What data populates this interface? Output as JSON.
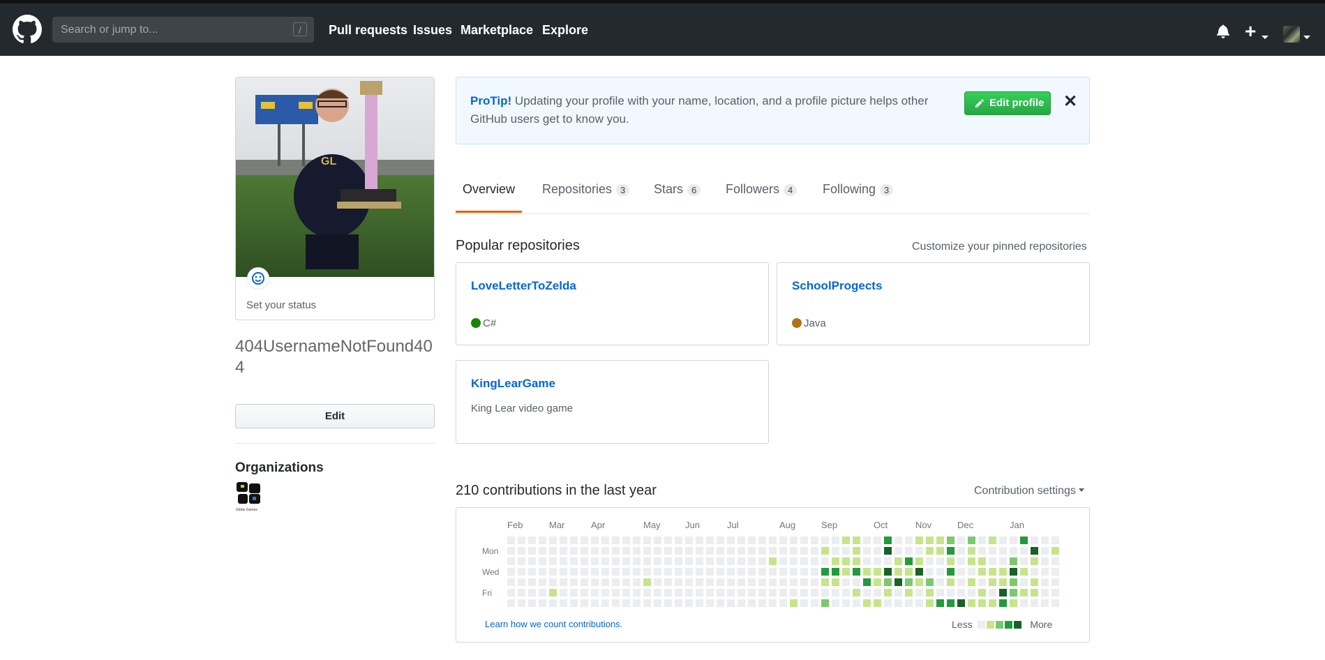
{
  "header": {
    "search_placeholder": "Search or jump to...",
    "search_hint": "/",
    "nav": [
      "Pull requests",
      "Issues",
      "Marketplace",
      "Explore"
    ]
  },
  "profile": {
    "status_text": "Set your status",
    "username": "404UsernameNotFound404",
    "edit_label": "Edit",
    "organizations_title": "Organizations",
    "org_name": "Glebe Games"
  },
  "protip": {
    "label": "ProTip!",
    "text": "Updating your profile with your name, location, and a profile picture helps other GitHub users get to know you.",
    "button": "Edit profile",
    "close": "✕"
  },
  "tabs": [
    {
      "label": "Overview",
      "count": ""
    },
    {
      "label": "Repositories",
      "count": "3"
    },
    {
      "label": "Stars",
      "count": "6"
    },
    {
      "label": "Followers",
      "count": "4"
    },
    {
      "label": "Following",
      "count": "3"
    }
  ],
  "popular": {
    "title": "Popular repositories",
    "customize": "Customize your pinned repositories",
    "repos": [
      {
        "name": "LoveLetterToZelda",
        "lang": "C#",
        "lang_color": "#178600",
        "desc": ""
      },
      {
        "name": "SchoolProgects",
        "lang": "Java",
        "lang_color": "#b07219",
        "desc": ""
      },
      {
        "name": "KingLearGame",
        "lang": "",
        "lang_color": "",
        "desc": "King Lear video game"
      }
    ]
  },
  "contributions": {
    "title": "210 contributions in the last year",
    "settings": "Contribution settings",
    "months": [
      "Feb",
      "Mar",
      "Apr",
      "May",
      "Jun",
      "Jul",
      "Aug",
      "Sep",
      "Oct",
      "Nov",
      "Dec",
      "Jan"
    ],
    "day_labels": [
      "Mon",
      "Wed",
      "Fri"
    ],
    "learn": "Learn how we count contributions.",
    "less": "Less",
    "more": "More",
    "colors": [
      "#ebedf0",
      "#c6e48b",
      "#7bc96f",
      "#239a3b",
      "#196127"
    ]
  }
}
